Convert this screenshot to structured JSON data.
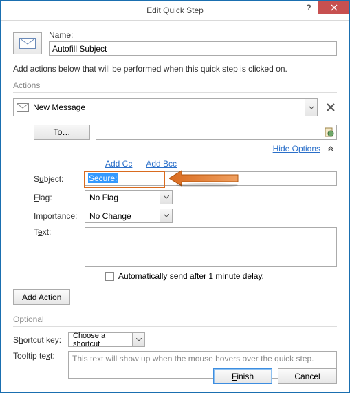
{
  "titlebar": {
    "title": "Edit Quick Step"
  },
  "name": {
    "label": "Name:",
    "value": "Autofill Subject"
  },
  "instruction": "Add actions below that will be performed when this quick step is clicked on.",
  "actions_label": "Actions",
  "action": {
    "selected": "New Message",
    "to_label": "To…",
    "hide_options": "Hide Options",
    "add_cc": "Add Cc",
    "add_bcc": "Add Bcc",
    "subject_label": "Subject:",
    "subject_value": "Secure:",
    "flag_label": "Flag:",
    "flag_value": "No Flag",
    "importance_label": "Importance:",
    "importance_value": "No Change",
    "text_label": "Text:",
    "auto_send_label": "Automatically send after 1 minute delay."
  },
  "add_action_btn": "Add Action",
  "optional": {
    "label": "Optional",
    "shortcut_label": "Shortcut key:",
    "shortcut_value": "Choose a shortcut",
    "tooltip_label": "Tooltip text:",
    "tooltip_placeholder": "This text will show up when the mouse hovers over the quick step."
  },
  "footer": {
    "finish": "Finish",
    "cancel": "Cancel"
  }
}
